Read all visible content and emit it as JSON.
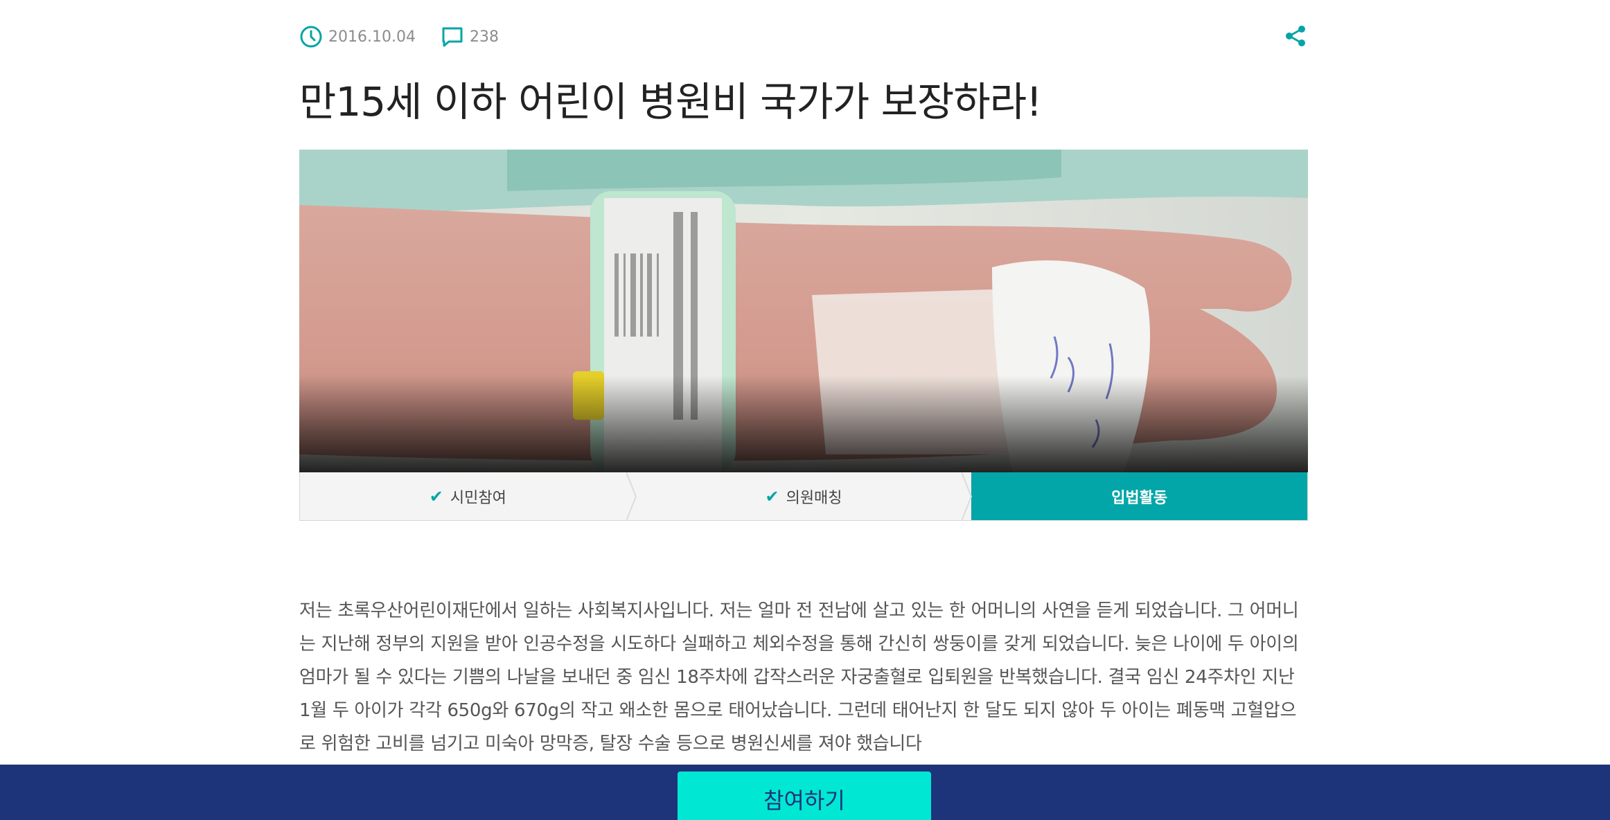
{
  "post": {
    "date": "2016.10.04",
    "comment_count": "238",
    "title": "만15세 이하 어린이 병원비 국가가 보장하라!",
    "share_icon": "share-icon"
  },
  "hero": {
    "image_desc_icon": "photo"
  },
  "steps": [
    {
      "label": "시민참여",
      "done": true
    },
    {
      "label": "의원매칭",
      "done": true
    },
    {
      "label": "입법활동",
      "active": true
    }
  ],
  "content": {
    "paragraph": "저는 초록우산어린이재단에서 일하는 사회복지사입니다. 저는 얼마 전 전남에 살고 있는 한 어머니의 사연을 듣게 되었습니다. 그 어머니는 지난해 정부의 지원을 받아 인공수정을 시도하다 실패하고 체외수정을 통해 간신히 쌍둥이를 갖게 되었습니다. 늦은 나이에 두 아이의 엄마가 될 수 있다는 기쁨의 나날을 보내던 중 임신 18주차에 갑작스러운 자궁출혈로 입퇴원을 반복했습니다. 결국 임신 24주차인 지난 1월 두 아이가 각각 650g와 670g의 작고 왜소한 몸으로 태어났습니다. 그런데 태어난지 한 달도 되지 않아 두 아이는 폐동맥 고혈압으로 위험한 고비를 넘기고 미숙아 망막증, 탈장 수술 등으로 병원신세를 져야 했습니다"
  },
  "footer": {
    "join_label": "참여하기"
  },
  "colors": {
    "accent": "#03a6a8",
    "footer_bg": "#1e347a",
    "join_button": "#00e8d3"
  }
}
